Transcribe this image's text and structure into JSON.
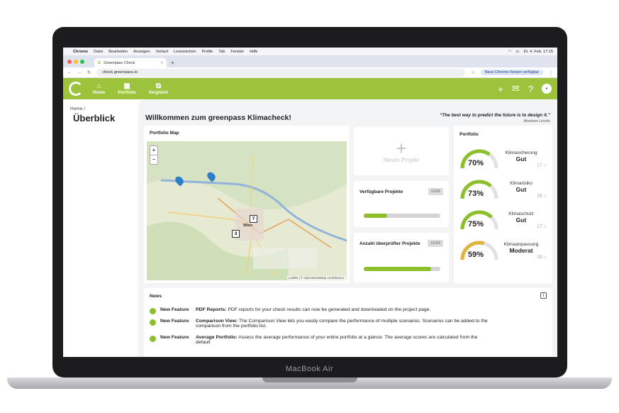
{
  "device": {
    "label": "MacBook Air"
  },
  "macmenu": {
    "app": "Chrome",
    "items": [
      "Datei",
      "Bearbeiten",
      "Anzeigen",
      "Verlauf",
      "Lesezeichen",
      "Profile",
      "Tab",
      "Fenster",
      "Hilfe"
    ],
    "datetime": "Di. 4. Feb.  17:15"
  },
  "browser": {
    "tab_title": "Greenpass Check",
    "url": "check.greenpass.io",
    "update_label": "Neue Chrome-Version verfügbar"
  },
  "nav": {
    "home": "Home",
    "portfolio": "Portfolio",
    "vergleich": "Vergleich"
  },
  "page": {
    "breadcrumb": "Home",
    "title": "Überblick",
    "welcome": "Willkommen zum greenpass Klimacheck!",
    "quote": "“The best way to predict the future is to design it.”",
    "quote_author": "Abraham Lincoln"
  },
  "map": {
    "title": "Portfolio Map",
    "zoom_in": "+",
    "zoom_out": "−",
    "cluster_a": "7",
    "cluster_b": "3",
    "city": "Wien",
    "attribution": "Leaflet | © OpenStreetMap contributors"
  },
  "new_project": {
    "label": "Neues Projekt",
    "icon": "plus-icon"
  },
  "stats": [
    {
      "label": "Verfügbare Projekte",
      "badge": "11/35",
      "progress": 0.31
    },
    {
      "label": "Anzahl überprüfter Projekte",
      "badge": "21/24",
      "progress": 0.875
    }
  ],
  "portfolio": {
    "title": "Portfolio",
    "items": [
      {
        "value": "70%",
        "name": "Klimasicherung",
        "rating": "Gut",
        "count": "17",
        "level": 0.7,
        "color": "#8cbf2a"
      },
      {
        "value": "73%",
        "name": "Klimarisiko",
        "rating": "Gut",
        "count": "18",
        "level": 0.73,
        "color": "#8cbf2a"
      },
      {
        "value": "75%",
        "name": "Klimaschutz",
        "rating": "Gut",
        "count": "17",
        "level": 0.75,
        "color": "#8cbf2a"
      },
      {
        "value": "59%",
        "name": "Klimaanpassung",
        "rating": "Moderat",
        "count": "18",
        "level": 0.59,
        "color": "#e0b341"
      }
    ]
  },
  "news": {
    "title": "News",
    "items": [
      {
        "tag": "New Feature",
        "head": "PDF Reports:",
        "text": " PDF reports for your check results can now be generated and downloaded on the project page."
      },
      {
        "tag": "New Feature",
        "head": "Comparison View:",
        "text": " The Comparison View lets you easily compare the performance of multiple scenarios. Scenarios can be added to the comparison from the portfolio list."
      },
      {
        "tag": "New Feature",
        "head": "Average Portfolio:",
        "text": " Assess the average performance of your entire portfolio at a glance. The average scores are calculated from the default"
      }
    ]
  }
}
